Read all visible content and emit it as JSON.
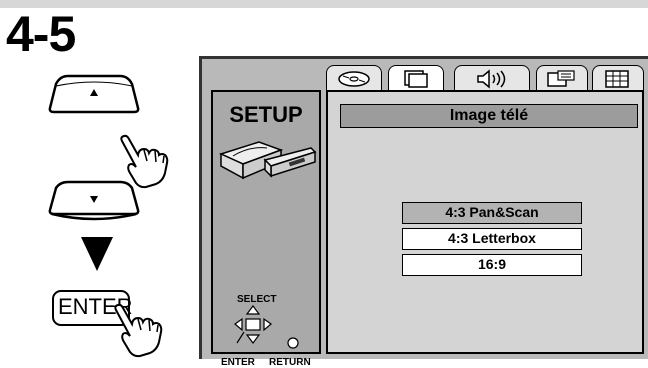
{
  "step": {
    "label": "4-5"
  },
  "remote": {
    "up_button": "up-arrow-button",
    "down_button": "down-arrow-button",
    "enter_label": "ENTER"
  },
  "osd": {
    "side": {
      "title": "SETUP",
      "select_label": "SELECT",
      "enter_label": "ENTER",
      "return_label": "RETURN"
    },
    "tabs": [
      {
        "icon": "disc-icon",
        "active": false
      },
      {
        "icon": "tv-screen-icon",
        "active": true
      },
      {
        "icon": "speaker-icon",
        "active": false
      },
      {
        "icon": "multi-screen-icon",
        "active": false
      },
      {
        "icon": "grid-icon",
        "active": false
      }
    ],
    "menu": {
      "title": "Image télé",
      "options": [
        {
          "label": "4:3 Pan&Scan",
          "selected": true
        },
        {
          "label": "4:3 Letterbox",
          "selected": false
        },
        {
          "label": "16:9",
          "selected": false
        }
      ]
    }
  },
  "colors": {
    "screen_bg": "#b9b9b9",
    "panel_bg": "#d4d4d4",
    "highlight": "#b3b3b3"
  }
}
